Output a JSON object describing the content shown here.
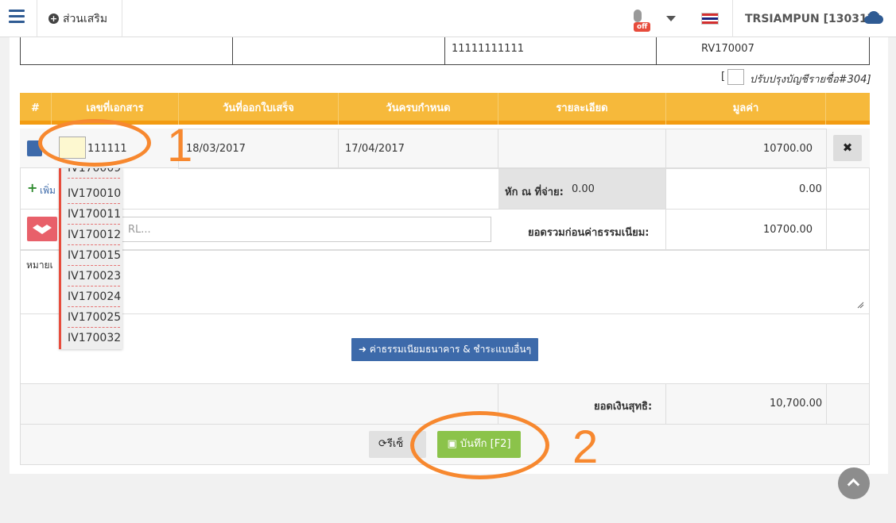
{
  "topbar": {
    "addon_label": "ส่วนเสริม",
    "mic_status": "off",
    "user_label": "TRSIAMPUN [130317]"
  },
  "prev_row": {
    "account_no": "11111111111",
    "ref": "RV170007"
  },
  "update_checkbox": {
    "open_bracket": "[",
    "label": "ปรับปรุงบัญชีรายชื่อ#304]"
  },
  "table": {
    "headers": [
      "#",
      "เลขที่เอกสาร",
      "วันที่ออกใบเสร็จ",
      "วันครบกำหนด",
      "รายละเอียด",
      "มูลค่า"
    ],
    "row": {
      "doc_no_partial": "111111",
      "issue_date": "18/03/2017",
      "due_date": "17/04/2017",
      "value": "10700.00",
      "delete_symbol": "✖"
    },
    "add_label": "เพิ่ม",
    "withholding_label": "หัก ณ ที่จ่าย:",
    "withholding_value": "0.00",
    "withholding_amount": "0.00",
    "url_placeholder": "RL...",
    "subtotal_label": "ยอดรวมก่อนค่าธรรมเนียม:",
    "subtotal_value": "10700.00",
    "notes_label_partial": "หมายเ",
    "bank_fee_button": "ค่าธรรมเนียมธนาคาร & ชำระแบบอื่นๆ",
    "net_label": "ยอดเงินสุทธิ:",
    "net_value": "10,700.00"
  },
  "dropdown": {
    "items": [
      "IV170009",
      "IV170010",
      "IV170011",
      "IV170012",
      "IV170015",
      "IV170023",
      "IV170024",
      "IV170025",
      "IV170032"
    ]
  },
  "actions": {
    "reset_label": "รีเซ็",
    "save_label": "บันทึก [F2]"
  },
  "annotations": {
    "one": "1",
    "two": "2"
  },
  "colors": {
    "header": "#f6b93b",
    "annotation": "#f7882f",
    "save": "#8bc34a",
    "primary": "#3d6aaa"
  }
}
